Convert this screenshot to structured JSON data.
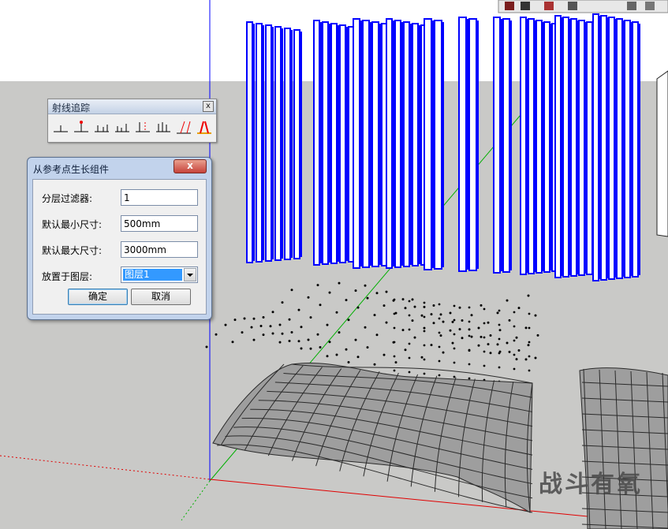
{
  "toolbar": {
    "title": "射线追踪",
    "close": "x",
    "tools": [
      "ray-tool-1",
      "ray-tool-2",
      "ray-tool-3",
      "ray-tool-4",
      "ray-tool-5",
      "ray-tool-6",
      "ray-tool-7",
      "ray-tool-8"
    ]
  },
  "dialog": {
    "title": "从参考点生长组件",
    "close": "x",
    "fields": [
      {
        "label": "分层过滤器:",
        "value": "1"
      },
      {
        "label": "默认最小尺寸:",
        "value": "500mm"
      },
      {
        "label": "默认最大尺寸:",
        "value": "3000mm"
      }
    ],
    "layer_label": "放置于图层:",
    "layer_value": "图层1",
    "ok_label": "确定",
    "cancel_label": "取消"
  },
  "watermark": "战斗有氧",
  "colors": {
    "sky": "#ffffff",
    "ground": "#c9c9c7",
    "panel_blue": "#0000ff",
    "axis_red": "#e00000",
    "axis_green": "#00b000",
    "axis_blue": "#0000ff"
  }
}
